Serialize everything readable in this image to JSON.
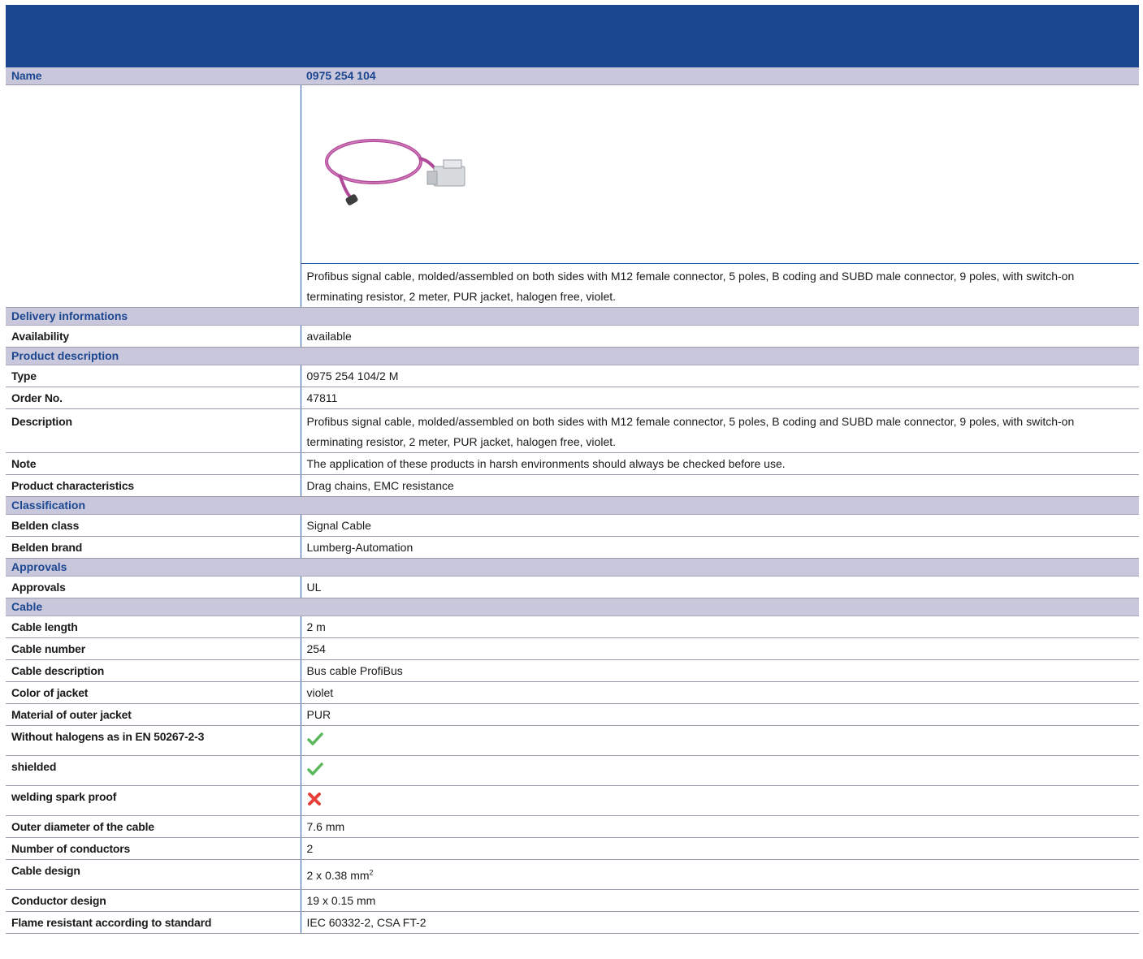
{
  "header": {
    "name_label": "Name",
    "name_value": "0975 254 104"
  },
  "intro_description": "Profibus signal cable, molded/assembled on both sides with M12 female connector, 5 poles, B coding and SUBD male connector, 9 poles, with switch-on terminating resistor, 2 meter, PUR jacket, halogen free, violet.",
  "product_image": "violet-profibus-cable-with-m12-and-subd-connectors",
  "sections": {
    "delivery": {
      "title": "Delivery informations",
      "rows": [
        {
          "label": "Availability",
          "value": "available"
        }
      ]
    },
    "product": {
      "title": "Product description",
      "rows": [
        {
          "label": "Type",
          "value": "0975 254 104/2 M"
        },
        {
          "label": "Order No.",
          "value": "47811"
        },
        {
          "label": "Description",
          "value": "Profibus signal cable, molded/assembled on both sides with M12 female connector, 5 poles, B coding and SUBD male connector, 9 poles, with switch-on terminating resistor, 2 meter, PUR jacket, halogen free, violet."
        },
        {
          "label": "Note",
          "value": "The application of these products in harsh environments should always be checked before use."
        },
        {
          "label": "Product characteristics",
          "value": "Drag chains, EMC resistance"
        }
      ]
    },
    "classification": {
      "title": "Classification",
      "rows": [
        {
          "label": "Belden class",
          "value": "Signal Cable"
        },
        {
          "label": "Belden brand",
          "value": "Lumberg-Automation"
        }
      ]
    },
    "approvals": {
      "title": "Approvals",
      "rows": [
        {
          "label": "Approvals",
          "value": "UL"
        }
      ]
    },
    "cable": {
      "title": "Cable",
      "rows": [
        {
          "label": "Cable length",
          "value": "2 m"
        },
        {
          "label": "Cable number",
          "value": "254"
        },
        {
          "label": "Cable description",
          "value": "Bus cable ProfiBus"
        },
        {
          "label": "Color of jacket",
          "value": "violet"
        },
        {
          "label": "Material of outer jacket",
          "value": "PUR"
        },
        {
          "label": "Without halogens as in EN 50267-2-3",
          "icon": "checkmark-icon"
        },
        {
          "label": "shielded",
          "icon": "checkmark-icon"
        },
        {
          "label": "welding spark proof",
          "icon": "cross-icon"
        },
        {
          "label": "Outer diameter of the cable",
          "value": "7.6 mm"
        },
        {
          "label": "Number of conductors",
          "value": "2"
        },
        {
          "label": "Cable design",
          "value": "2 x 0.38 mm",
          "superscript": "2"
        },
        {
          "label": "Conductor design",
          "value": "19 x 0.15 mm"
        },
        {
          "label": "Flame resistant according to standard",
          "value": "IEC 60332-2, CSA FT-2"
        }
      ]
    }
  },
  "colors": {
    "banner": "#1b4790",
    "section_bg": "#c9c7dc",
    "section_text": "#1b4790",
    "check": "#5cb85c",
    "cross": "#e8413c"
  }
}
